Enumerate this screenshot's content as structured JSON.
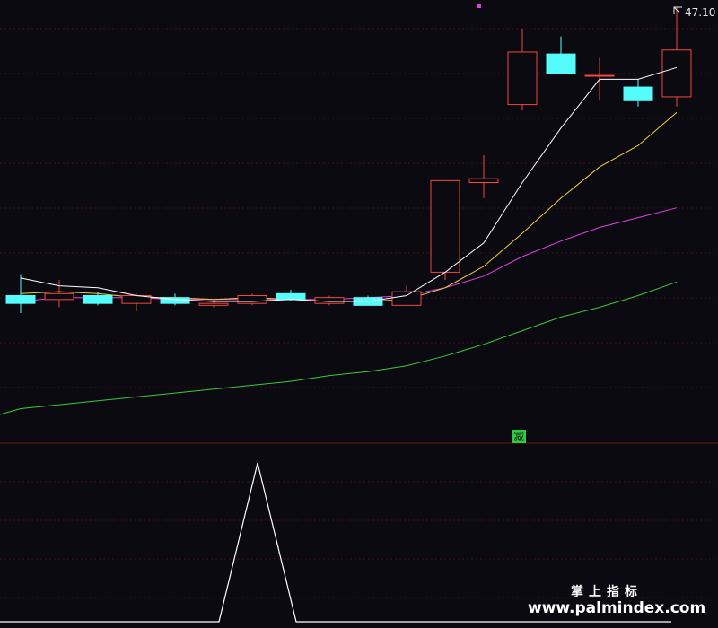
{
  "chart_data": {
    "type": "candlestick",
    "bars": [
      {
        "o": 45.62,
        "h": 45.73,
        "l": 45.53,
        "c": 45.58
      },
      {
        "o": 45.6,
        "h": 45.7,
        "l": 45.56,
        "c": 45.63
      },
      {
        "o": 45.62,
        "h": 45.64,
        "l": 45.57,
        "c": 45.58
      },
      {
        "o": 45.58,
        "h": 45.63,
        "l": 45.54,
        "c": 45.62
      },
      {
        "o": 45.61,
        "h": 45.63,
        "l": 45.57,
        "c": 45.58
      },
      {
        "o": 45.57,
        "h": 45.6,
        "l": 45.56,
        "c": 45.58
      },
      {
        "o": 45.58,
        "h": 45.63,
        "l": 45.57,
        "c": 45.62
      },
      {
        "o": 45.63,
        "h": 45.65,
        "l": 45.59,
        "c": 45.6
      },
      {
        "o": 45.58,
        "h": 45.62,
        "l": 45.57,
        "c": 45.61
      },
      {
        "o": 45.61,
        "h": 45.62,
        "l": 45.57,
        "c": 45.57
      },
      {
        "o": 45.57,
        "h": 45.67,
        "l": 45.57,
        "c": 45.64
      },
      {
        "o": 45.74,
        "h": 46.1,
        "l": 45.7,
        "c": 46.21
      },
      {
        "o": 46.2,
        "h": 46.34,
        "l": 46.12,
        "c": 46.22
      },
      {
        "o": 46.6,
        "h": 46.99,
        "l": 46.57,
        "c": 46.87
      },
      {
        "o": 46.86,
        "h": 46.95,
        "l": 46.77,
        "c": 46.76
      },
      {
        "o": 46.75,
        "h": 46.84,
        "l": 46.62,
        "c": 46.75
      },
      {
        "o": 46.69,
        "h": 46.73,
        "l": 46.59,
        "c": 46.62
      },
      {
        "o": 46.64,
        "h": 47.1,
        "l": 46.59,
        "c": 46.88
      }
    ],
    "ma_white": [
      45.71,
      45.67,
      45.66,
      45.62,
      45.6,
      45.59,
      45.59,
      45.6,
      45.59,
      45.59,
      45.62,
      45.74,
      45.89,
      46.2,
      46.48,
      46.73,
      46.73,
      46.79
    ],
    "ma_yellow": [
      45.63,
      45.64,
      45.63,
      45.61,
      45.61,
      45.6,
      45.61,
      45.6,
      45.59,
      45.59,
      45.6,
      45.66,
      45.77,
      45.94,
      46.12,
      46.28,
      46.39,
      46.56
    ],
    "ma_magenta": [
      45.59,
      45.61,
      45.61,
      45.61,
      45.6,
      45.6,
      45.6,
      45.6,
      45.6,
      45.61,
      45.62,
      45.66,
      45.72,
      45.82,
      45.9,
      45.97,
      46.02,
      46.07
    ],
    "ma_green_start": 45.01,
    "ma_green": [
      45.04,
      45.06,
      45.08,
      45.1,
      45.12,
      45.14,
      45.16,
      45.18,
      45.21,
      45.23,
      45.26,
      45.31,
      45.37,
      45.44,
      45.51,
      45.56,
      45.62,
      45.69
    ],
    "indicator": [
      0,
      0,
      0,
      0,
      0,
      0,
      1,
      0,
      0,
      0,
      0,
      0,
      0,
      0,
      0,
      0,
      0,
      0
    ],
    "price_label": "47.10",
    "signal_label": "减",
    "colors": {
      "background": "#0b0a10",
      "up": "#f0483c",
      "down": "#54fcfc",
      "ma_white": "#ffffff",
      "ma_yellow": "#f0d040",
      "ma_magenta": "#e040e0",
      "ma_green": "#3cc83c",
      "grid": "#4a1515",
      "signal_bg": "#2ecc40"
    }
  },
  "watermark": {
    "chinese": "掌上指标",
    "url": "www.palmindex.com"
  }
}
